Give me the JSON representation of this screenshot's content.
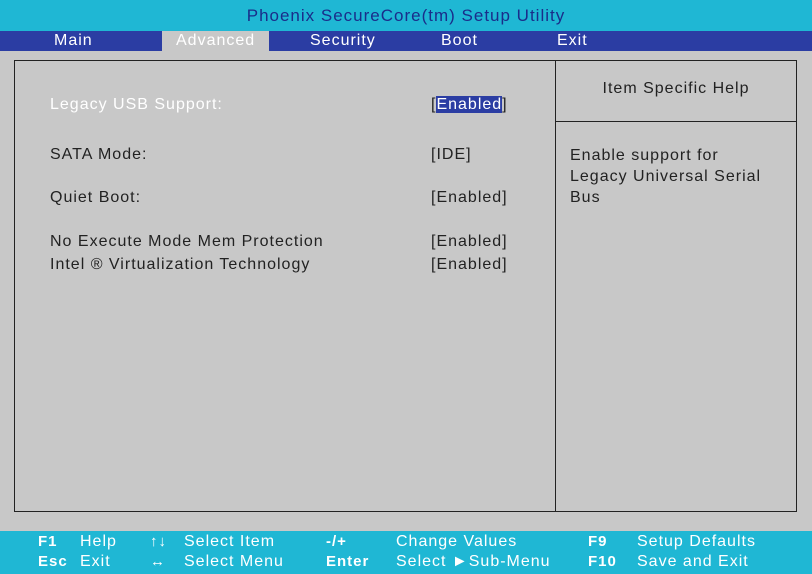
{
  "title": "Phoenix SecureCore(tm) Setup Utility",
  "menu": [
    "Main",
    "Advanced",
    "Security",
    "Boot",
    "Exit"
  ],
  "selected_menu": "Advanced",
  "settings": [
    {
      "label": "Legacy USB Support:",
      "value": "Enabled",
      "selected": true
    },
    {
      "label": "SATA Mode:",
      "value": "[IDE]"
    },
    {
      "label": "Quiet Boot:",
      "value": "[Enabled]"
    },
    {
      "label": "No Execute Mode Mem Protection",
      "value": "[Enabled]"
    },
    {
      "label": "Intel ® Virtualization Technology",
      "value": "[Enabled]"
    }
  ],
  "help": {
    "title": "Item Specific Help",
    "lines": [
      "Enable support for",
      "Legacy Universal Serial",
      "Bus"
    ]
  },
  "status": {
    "row1": [
      {
        "key": "F1",
        "desc": "Help"
      },
      {
        "key": "↑↓",
        "desc": "Select  Item"
      },
      {
        "key": "-/+",
        "desc": "Change Values"
      },
      {
        "key": "F9",
        "desc": "Setup Defaults"
      }
    ],
    "row2": [
      {
        "key": "Esc",
        "desc": "Exit"
      },
      {
        "key": "↔",
        "desc": "Select  Menu"
      },
      {
        "key": "Enter",
        "desc": "Select  ►Sub-Menu"
      },
      {
        "key": "F10",
        "desc": "Save and Exit"
      }
    ]
  },
  "colors": {
    "title_bar": "#1fb7d4",
    "menu_bar": "#2b3da3",
    "background": "#c8c8c8",
    "highlight": "#2b3da3"
  }
}
